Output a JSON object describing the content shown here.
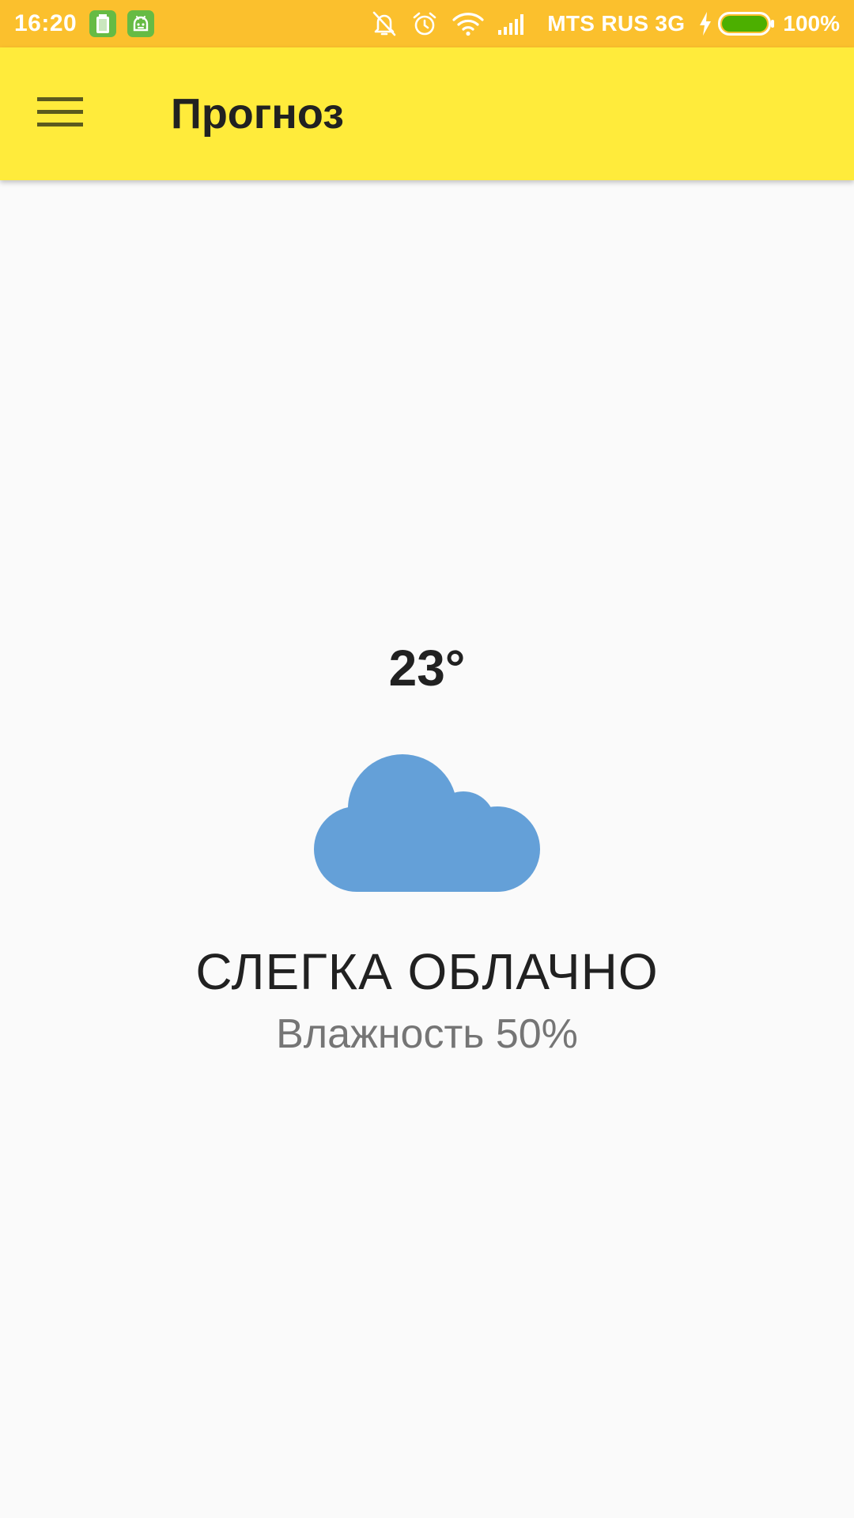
{
  "status_bar": {
    "time": "16:20",
    "carrier": "MTS RUS 3G",
    "battery_percent": "100%",
    "background_color": "#fbc02d",
    "notification_icons": [
      "battery-app-icon",
      "android-robot-icon"
    ],
    "system_icons": [
      "bell-muted-icon",
      "alarm-clock-icon",
      "wifi-icon",
      "signal-icon",
      "charging-bolt-icon",
      "battery-icon"
    ]
  },
  "app_bar": {
    "title": "Прогноз",
    "background_color": "#ffeb3b",
    "menu_icon": "hamburger-menu-icon"
  },
  "weather": {
    "temperature": "23°",
    "icon": "cloud-icon",
    "icon_color": "#64a0d8",
    "condition": "СЛЕГКА ОБЛАЧНО",
    "humidity": "Влажность 50%"
  }
}
